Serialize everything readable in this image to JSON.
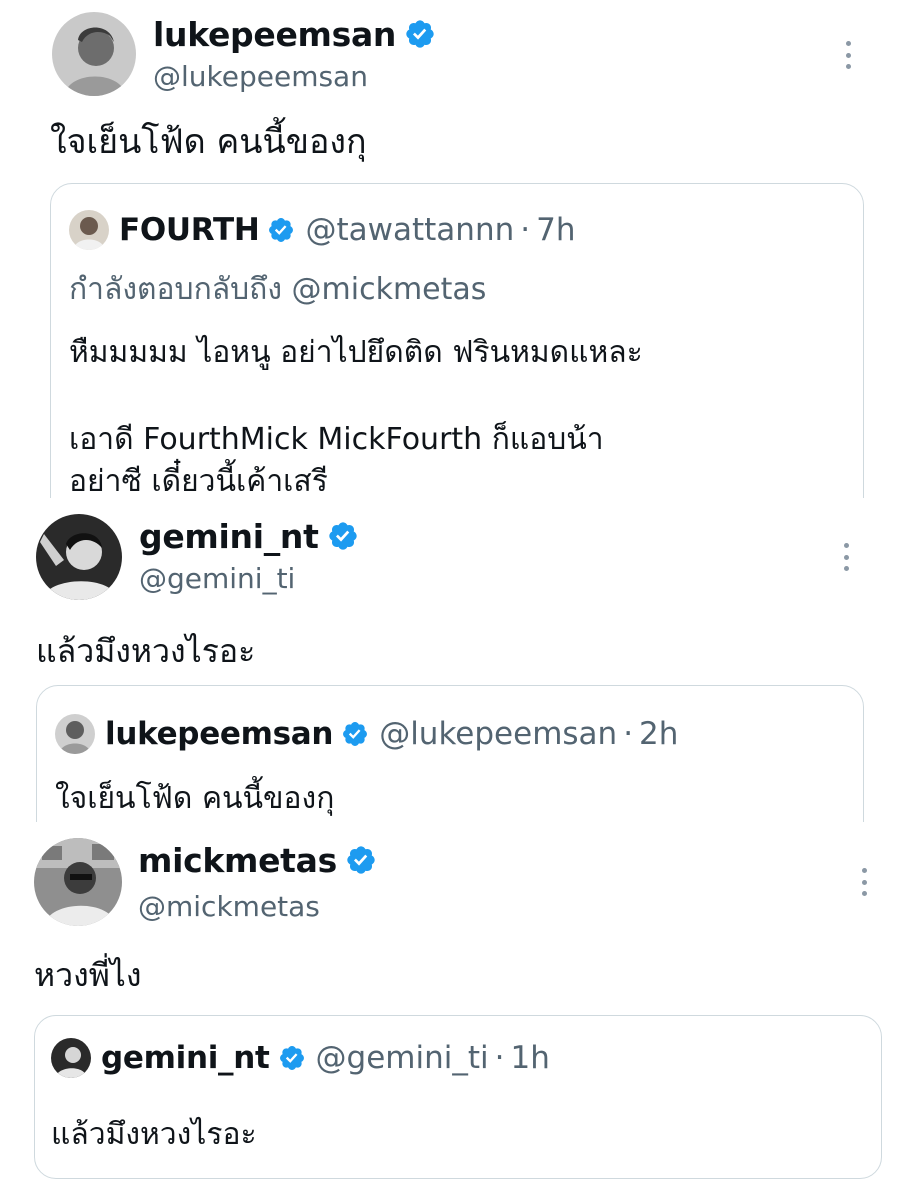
{
  "tweets": [
    {
      "display_name": "lukepeemsan",
      "handle": "@lukepeemsan",
      "text": "ใจเย็นโฟ้ด คนนี้ของกุ",
      "quote": {
        "display_name": "FOURTH",
        "handle": "@tawattannn",
        "time": "7h",
        "separator": "·",
        "reply_to": "กำลังตอบกลับถึง @mickmetas",
        "lines": [
          "หืมมมมม ไอหนู อย่าไปยึดติด ฟรินหมดแหละ",
          "",
          "เอาดี FourthMick MickFourth ก็แอบน้า",
          "อย่าซี เดี๋ยวนี้เค้าเสรี"
        ]
      }
    },
    {
      "display_name": "gemini_nt",
      "handle": "@gemini_ti",
      "text": "แล้วมึงหวงไรอะ",
      "quote": {
        "display_name": "lukepeemsan",
        "handle": "@lukepeemsan",
        "time": "2h",
        "separator": "·",
        "lines": [
          "ใจเย็นโฟ้ด คนนี้ของกุ"
        ]
      }
    },
    {
      "display_name": "mickmetas",
      "handle": "@mickmetas",
      "text": "หวงพี่ไง",
      "quote": {
        "display_name": "gemini_nt",
        "handle": "@gemini_ti",
        "time": "1h",
        "separator": "·",
        "lines": [
          "แล้วมึงหวงไรอะ"
        ]
      }
    }
  ],
  "icons": {
    "verified": "verified-badge-icon",
    "more": "more-options-icon"
  },
  "colors": {
    "verified_blue": "#1d9bf0",
    "secondary_text": "#536471",
    "border": "#cfd9de"
  }
}
